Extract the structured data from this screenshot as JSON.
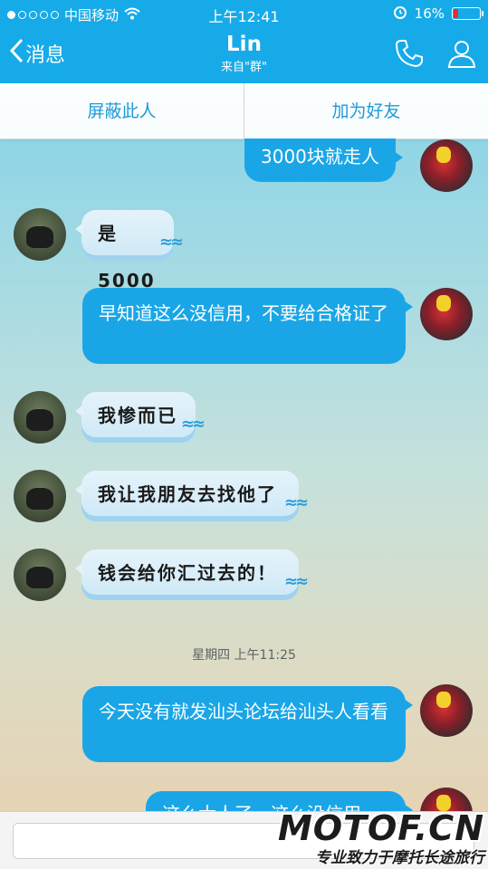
{
  "status_bar": {
    "carrier": "中国移动",
    "time": "上午12:41",
    "battery_text": "16%",
    "battery_level": 0.16
  },
  "nav": {
    "back_label": "消息",
    "title": "Lin",
    "subtitle": "来自\"群\""
  },
  "actions": {
    "block_label": "屏蔽此人",
    "add_friend_label": "加为好友"
  },
  "messages": [
    {
      "side": "right",
      "text": "3000块就走人"
    },
    {
      "side": "left",
      "text": "是5000"
    },
    {
      "side": "right",
      "text": "早知道这么没信用，不要给合格证了"
    },
    {
      "side": "left",
      "text": "我惨而已"
    },
    {
      "side": "left",
      "text": "我让我朋友去找他了"
    },
    {
      "side": "left",
      "text": "钱会给你汇过去的！"
    },
    {
      "side": "right",
      "text": "今天没有就发汕头论坛给汕头人看看"
    },
    {
      "side": "right",
      "text": "这么大人了，这么没信用"
    }
  ],
  "timestamp": "星期四 上午11:25",
  "watermark": {
    "brand": "MOTOF.CN",
    "slogan": "专业致力于摩托长途旅行"
  },
  "colors": {
    "accent": "#16abe8",
    "bubble_right": "#1aa6e6",
    "action_text": "#1f9ad6"
  }
}
